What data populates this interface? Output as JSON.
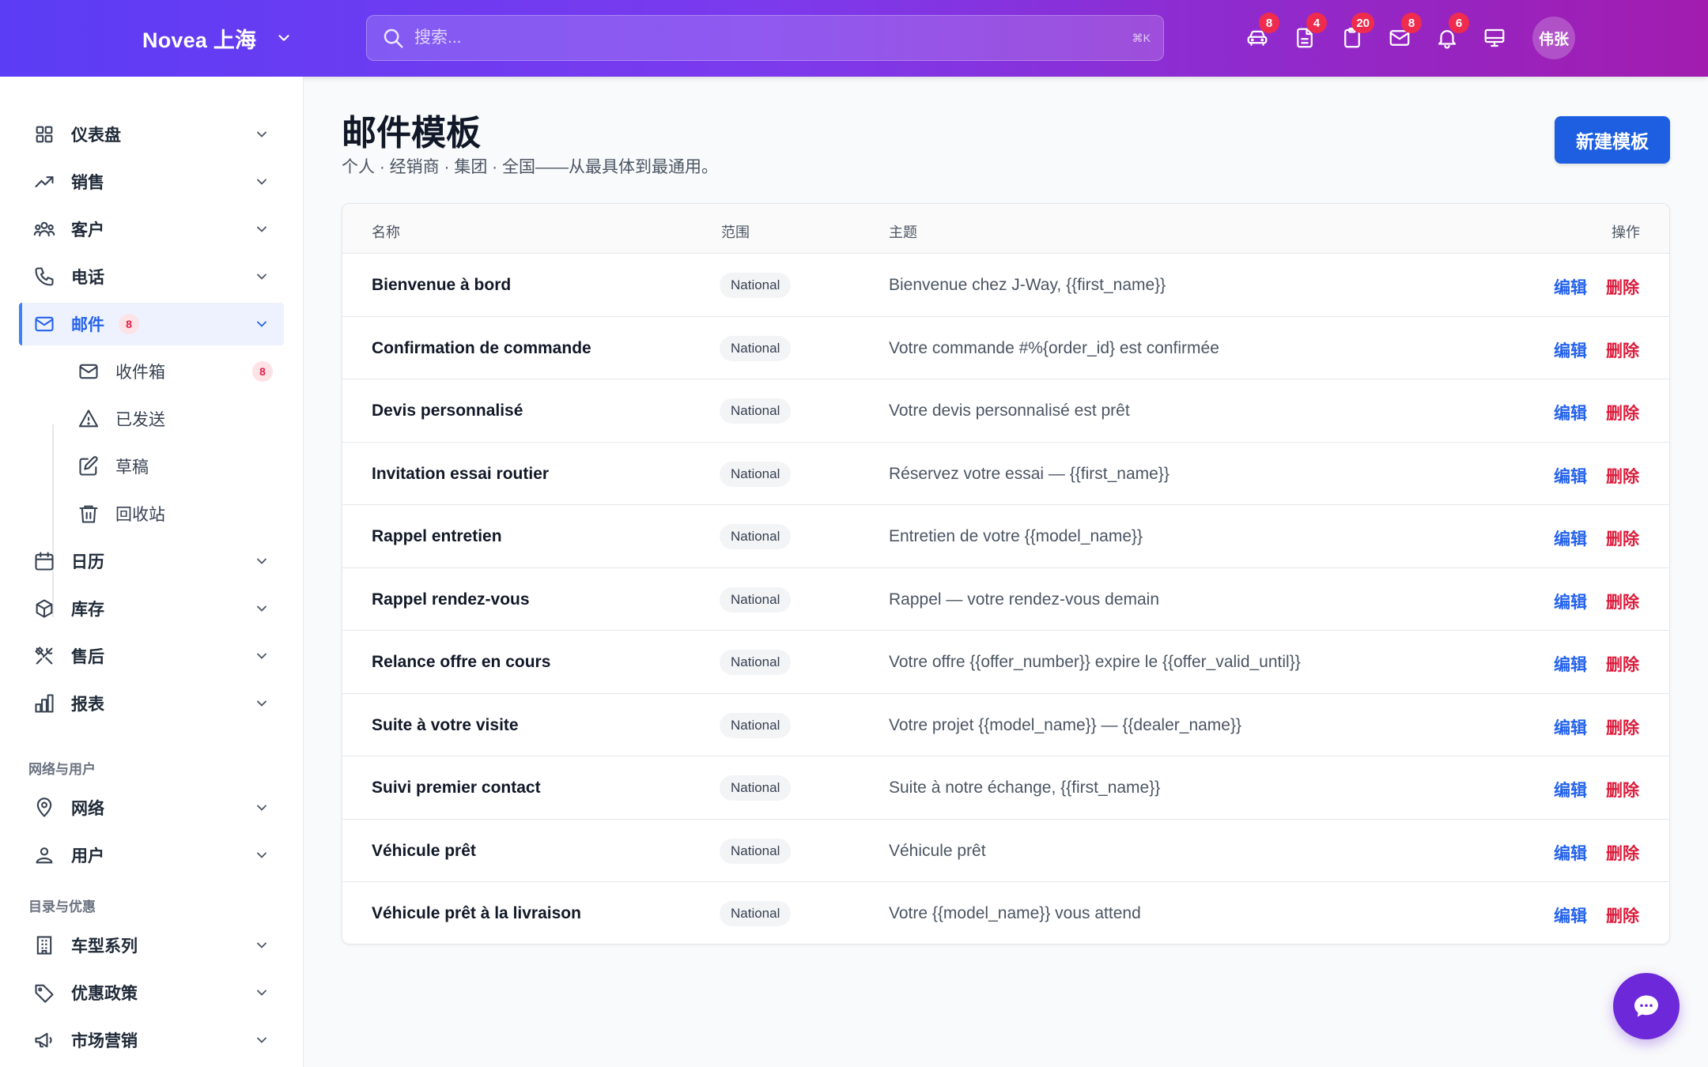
{
  "header": {
    "brand": "Novea 上海",
    "search_placeholder": "搜索...",
    "search_shortcut": "⌘K",
    "icons": [
      {
        "name": "car-icon",
        "badge": "8"
      },
      {
        "name": "document-icon",
        "badge": "4"
      },
      {
        "name": "clipboard-icon",
        "badge": "20"
      },
      {
        "name": "mail-icon",
        "badge": "8"
      },
      {
        "name": "bell-icon",
        "badge": "6"
      },
      {
        "name": "monitor-icon",
        "badge": ""
      }
    ],
    "avatar": "伟张"
  },
  "sidebar": {
    "items": [
      {
        "label": "仪表盘",
        "icon": "grid-icon"
      },
      {
        "label": "销售",
        "icon": "trending-up-icon"
      },
      {
        "label": "客户",
        "icon": "users-icon"
      },
      {
        "label": "电话",
        "icon": "phone-icon"
      },
      {
        "label": "邮件",
        "icon": "mail-icon",
        "badge": "8"
      },
      {
        "label": "日历",
        "icon": "calendar-icon"
      },
      {
        "label": "库存",
        "icon": "box-icon"
      },
      {
        "label": "售后",
        "icon": "tools-icon"
      },
      {
        "label": "报表",
        "icon": "bar-chart-icon"
      }
    ],
    "mail_sub": [
      {
        "label": "收件箱",
        "icon": "inbox-icon",
        "badge": "8"
      },
      {
        "label": "已发送",
        "icon": "send-icon"
      },
      {
        "label": "草稿",
        "icon": "edit-icon"
      },
      {
        "label": "回收站",
        "icon": "trash-icon"
      }
    ],
    "section_network": "网络与用户",
    "network_items": [
      {
        "label": "网络",
        "icon": "location-pin-icon"
      },
      {
        "label": "用户",
        "icon": "user-icon"
      }
    ],
    "section_catalog": "目录与优惠",
    "catalog_items": [
      {
        "label": "车型系列",
        "icon": "building-icon"
      },
      {
        "label": "优惠政策",
        "icon": "tag-icon"
      },
      {
        "label": "市场营销",
        "icon": "megaphone-icon"
      }
    ]
  },
  "main": {
    "title": "邮件模板",
    "subtitle": "个人 · 经销商 · 集团 · 全国——从最具体到最通用。",
    "new_button": "新建模板",
    "columns": {
      "name": "名称",
      "scope": "范围",
      "subject": "主题",
      "actions": "操作"
    },
    "edit_label": "编辑",
    "delete_label": "删除",
    "rows": [
      {
        "name": "Bienvenue à bord",
        "scope": "National",
        "subject": "Bienvenue chez J-Way, {{first_name}}"
      },
      {
        "name": "Confirmation de commande",
        "scope": "National",
        "subject": "Votre commande #%{order_id} est confirmée"
      },
      {
        "name": "Devis personnalisé",
        "scope": "National",
        "subject": "Votre devis personnalisé est prêt"
      },
      {
        "name": "Invitation essai routier",
        "scope": "National",
        "subject": "Réservez votre essai — {{first_name}}"
      },
      {
        "name": "Rappel entretien",
        "scope": "National",
        "subject": "Entretien de votre {{model_name}}"
      },
      {
        "name": "Rappel rendez-vous",
        "scope": "National",
        "subject": "Rappel — votre rendez-vous demain"
      },
      {
        "name": "Relance offre en cours",
        "scope": "National",
        "subject": "Votre offre {{offer_number}} expire le {{offer_valid_until}}"
      },
      {
        "name": "Suite à votre visite",
        "scope": "National",
        "subject": "Votre projet {{model_name}} — {{dealer_name}}"
      },
      {
        "name": "Suivi premier contact",
        "scope": "National",
        "subject": "Suite à notre échange, {{first_name}}"
      },
      {
        "name": "Véhicule prêt",
        "scope": "National",
        "subject": "Véhicule prêt"
      },
      {
        "name": "Véhicule prêt à la livraison",
        "scope": "National",
        "subject": "Votre {{model_name}} vous attend"
      }
    ]
  },
  "chat_button_icon": "chat-icon",
  "colors": {
    "accent": "#1d5fe0",
    "danger": "#dc1c3c",
    "header_start": "#5b3df5",
    "header_end": "#a21caf"
  }
}
